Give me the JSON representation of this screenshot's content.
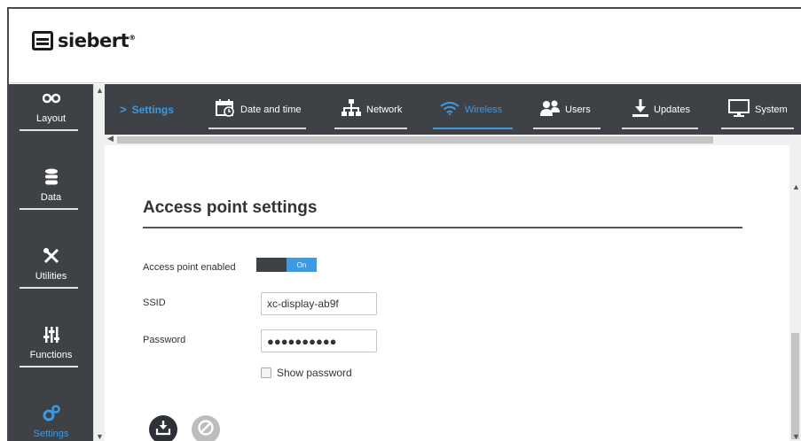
{
  "brand": {
    "name": "siebert",
    "reg": "®"
  },
  "sidebar": {
    "items": [
      {
        "label": "Layout",
        "icon": "layout-icon"
      },
      {
        "label": "Data",
        "icon": "database-icon"
      },
      {
        "label": "Utilities",
        "icon": "tools-icon"
      },
      {
        "label": "Functions",
        "icon": "sliders-icon"
      },
      {
        "label": "Settings",
        "icon": "gears-icon",
        "active": true
      }
    ]
  },
  "topnav": {
    "current": "Settings",
    "items": [
      {
        "label": "Date and time",
        "icon": "calendar-clock-icon"
      },
      {
        "label": "Network",
        "icon": "network-icon"
      },
      {
        "label": "Wireless",
        "icon": "wifi-icon",
        "active": true
      },
      {
        "label": "Users",
        "icon": "users-icon"
      },
      {
        "label": "Updates",
        "icon": "download-icon"
      },
      {
        "label": "System",
        "icon": "monitor-icon"
      }
    ]
  },
  "form": {
    "title": "Access point settings",
    "ap_enabled_label": "Access point enabled",
    "toggle_state": "On",
    "ssid_label": "SSID",
    "ssid_value": "xc-display-ab9f",
    "password_label": "Password",
    "password_value": "●●●●●●●●●●",
    "show_password_label": "Show password"
  },
  "colors": {
    "accent": "#3b9ae1",
    "dark": "#3e4247"
  }
}
